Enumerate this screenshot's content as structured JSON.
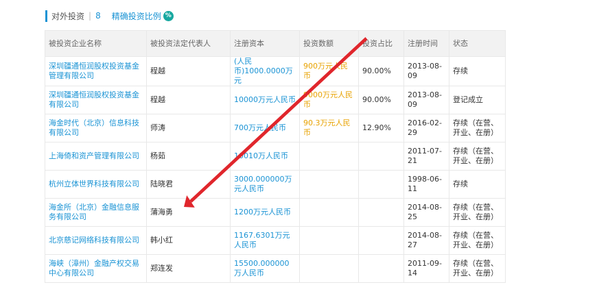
{
  "header": {
    "title": "对外投资",
    "separator": "|",
    "count": "8",
    "link": "精确投资比例",
    "icon": "%"
  },
  "columns": [
    "被投资企业名称",
    "被投资法定代表人",
    "注册资本",
    "投资数额",
    "投资占比",
    "注册时间",
    "状态"
  ],
  "rows": [
    {
      "company": "深圳疆通恒润股权投资基金管理有限公司",
      "legal_rep": "程越",
      "capital": "(人民币)1000.0000万元",
      "amount": "900万元人民币",
      "ratio": "90.00%",
      "date": "2013-08-09",
      "status": "存续"
    },
    {
      "company": "深圳疆通恒润股权投资基金有限公司",
      "legal_rep": "程越",
      "capital": "10000万元人民币",
      "amount": "9000万元人民币",
      "ratio": "90.00%",
      "date": "2013-08-09",
      "status": "登记成立"
    },
    {
      "company": "海金时代（北京）信息科技有限公司",
      "legal_rep": "师涛",
      "capital": "700万元人民币",
      "amount": "90.3万元人民币",
      "ratio": "12.90%",
      "date": "2016-02-29",
      "status": "存续（在营、开业、在册）"
    },
    {
      "company": "上海倚和资产管理有限公司",
      "legal_rep": "杨茹",
      "capital": "10010万人民币",
      "amount": "",
      "ratio": "",
      "date": "2011-07-21",
      "status": "存续（在营、开业、在册）"
    },
    {
      "company": "杭州立体世界科技有限公司",
      "legal_rep": "陆晓君",
      "capital": "3000.000000万元人民币",
      "amount": "",
      "ratio": "",
      "date": "1998-06-11",
      "status": "存续"
    },
    {
      "company": "海金所（北京）金融信息服务有限公司",
      "legal_rep": "蒲海勇",
      "capital": "1200万元人民币",
      "amount": "",
      "ratio": "",
      "date": "2014-08-25",
      "status": "存续（在营、开业、在册）"
    },
    {
      "company": "北京慈记网络科技有限公司",
      "legal_rep": "韩小红",
      "capital": "1167.6301万元人民币",
      "amount": "",
      "ratio": "",
      "date": "2014-08-27",
      "status": "存续（在营、开业、在册）"
    },
    {
      "company": "海峡（漳州）金融产权交易中心有限公司",
      "legal_rep": "郑连发",
      "capital": "15500.000000万人民币",
      "amount": "",
      "ratio": "",
      "date": "2011-09-14",
      "status": "存续（在营、开业、在册）"
    }
  ],
  "colors": {
    "accent": "#1a93d4",
    "amount": "#e8a200",
    "arrow": "#e0262c",
    "badge": "#17a8a0"
  }
}
